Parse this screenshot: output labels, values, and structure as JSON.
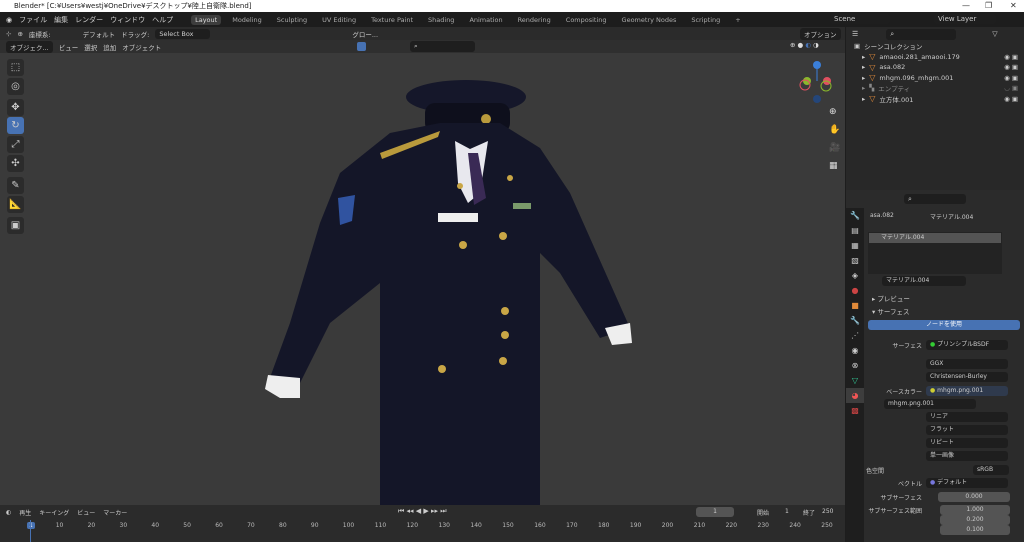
{
  "title": "Blender* [C:¥Users¥westj¥OneDrive¥デスクトップ¥陸上自衛隊.blend]",
  "window_controls": [
    "—",
    "❐",
    "✕"
  ],
  "menu": [
    "ファイル",
    "編集",
    "レンダー",
    "ウィンドウ",
    "ヘルプ"
  ],
  "workspaces": [
    "Layout",
    "Modeling",
    "Sculpting",
    "UV Editing",
    "Texture Paint",
    "Shading",
    "Animation",
    "Rendering",
    "Compositing",
    "Geometry Nodes",
    "Scripting",
    "+"
  ],
  "active_workspace": "Layout",
  "scene": "Scene",
  "view_layer": "View Layer",
  "vp_header": {
    "orientation_label": "座標系:",
    "pivot": "デフォルト",
    "drag_label": "ドラッグ:",
    "drag": "Select Box",
    "transform": "グロー...",
    "mode": "オブジェク...",
    "menus": [
      "ビュー",
      "選択",
      "追加",
      "オブジェクト"
    ],
    "options": "オプション"
  },
  "tools": [
    "select",
    "cursor",
    "move",
    "rotate",
    "scale",
    "transform",
    "annotate",
    "measure",
    "add-cube"
  ],
  "outliner": {
    "root": "シーンコレクション",
    "items": [
      {
        "name": "amaooi.281_amaooi.179"
      },
      {
        "name": "asa.082"
      },
      {
        "name": "mhgm.096_mhgm.001"
      },
      {
        "name": "エンプティ"
      },
      {
        "name": "立方体.001"
      }
    ]
  },
  "properties": {
    "object": "asa.082",
    "material": "マテリアル.004",
    "slot": "マテリアル.004",
    "preview": "プレビュー",
    "surface_panel": "サーフェス",
    "use_nodes": "ノードを使用",
    "surface_label": "サーフェス",
    "surface_value": "プリンシプルBSDF",
    "distribution": "GGX",
    "subsurface_method": "Christensen-Burley",
    "base_color_label": "ベースカラー",
    "base_color_value": "mhgm.png.001",
    "image": "mhgm.png.001",
    "interp": "リニア",
    "proj": "フラット",
    "ext": "リピート",
    "source": "単一画像",
    "colorspace_label": "色空間",
    "colorspace": "sRGB",
    "vector_label": "ベクトル",
    "vector": "デフォルト",
    "subsurface_label": "サブサーフェス",
    "subsurface": "0.000",
    "radius_label": "サブサーフェス範囲",
    "radius": [
      "1.000",
      "0.200",
      "0.100"
    ]
  },
  "timeline": {
    "menus": [
      "再生",
      "キーイング",
      "ビュー",
      "マーカー"
    ],
    "current": "1",
    "start_label": "開始",
    "start": "1",
    "end_label": "終了",
    "end": "250",
    "ticks": [
      "1",
      "10",
      "20",
      "30",
      "40",
      "50",
      "60",
      "70",
      "80",
      "90",
      "100",
      "110",
      "120",
      "130",
      "140",
      "150",
      "160",
      "170",
      "180",
      "190",
      "200",
      "210",
      "220",
      "230",
      "240",
      "250"
    ]
  },
  "colors": {
    "accent": "#4772b3",
    "mesh": "#e08a3a"
  }
}
